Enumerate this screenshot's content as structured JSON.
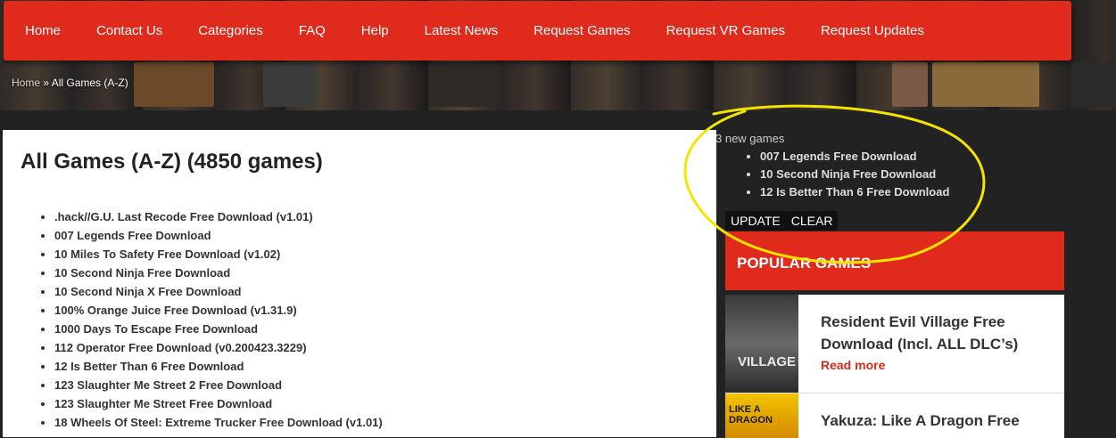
{
  "nav": [
    "Home",
    "Contact Us",
    "Categories",
    "FAQ",
    "Help",
    "Latest News",
    "Request Games",
    "Request VR Games",
    "Request Updates"
  ],
  "breadcrumb": {
    "home": "Home",
    "separator": " » ",
    "current": "All Games (A-Z)"
  },
  "main": {
    "title": "All Games (A-Z) (4850 games)",
    "games": [
      ".hack//G.U. Last Recode Free Download (v1.01)",
      "007 Legends Free Download",
      "10 Miles To Safety Free Download (v1.02)",
      "10 Second Ninja Free Download",
      "10 Second Ninja X Free Download",
      "100% Orange Juice Free Download (v1.31.9)",
      "1000 Days To Escape Free Download",
      "112 Operator Free Download (v0.200423.3229)",
      "12 Is Better Than 6 Free Download",
      "123 Slaughter Me Street 2 Free Download",
      "123 Slaughter Me Street Free Download",
      "18 Wheels Of Steel: Extreme Trucker Free Download (v1.01)"
    ]
  },
  "sidebar": {
    "new_count": "3 new games",
    "new_games": [
      "007 Legends Free Download",
      "10 Second Ninja Free Download",
      "12 Is Better Than 6 Free Download"
    ],
    "update_label": "UPDATE",
    "clear_label": "CLEAR",
    "popular_title": "POPULAR GAMES",
    "popular": [
      {
        "title": "Resident Evil Village Free Download (Incl. ALL DLC’s)",
        "more": "Read more",
        "thumb_label": "VILLAGE"
      },
      {
        "title": "Yakuza: Like A Dragon Free",
        "more": "",
        "thumb_label": "LIKE A DRAGON"
      }
    ]
  },
  "colors": {
    "nav_red": "#e02a1c",
    "dark_bg": "#222222",
    "link_red": "#d62b1b",
    "annotation": "#f5e400"
  }
}
